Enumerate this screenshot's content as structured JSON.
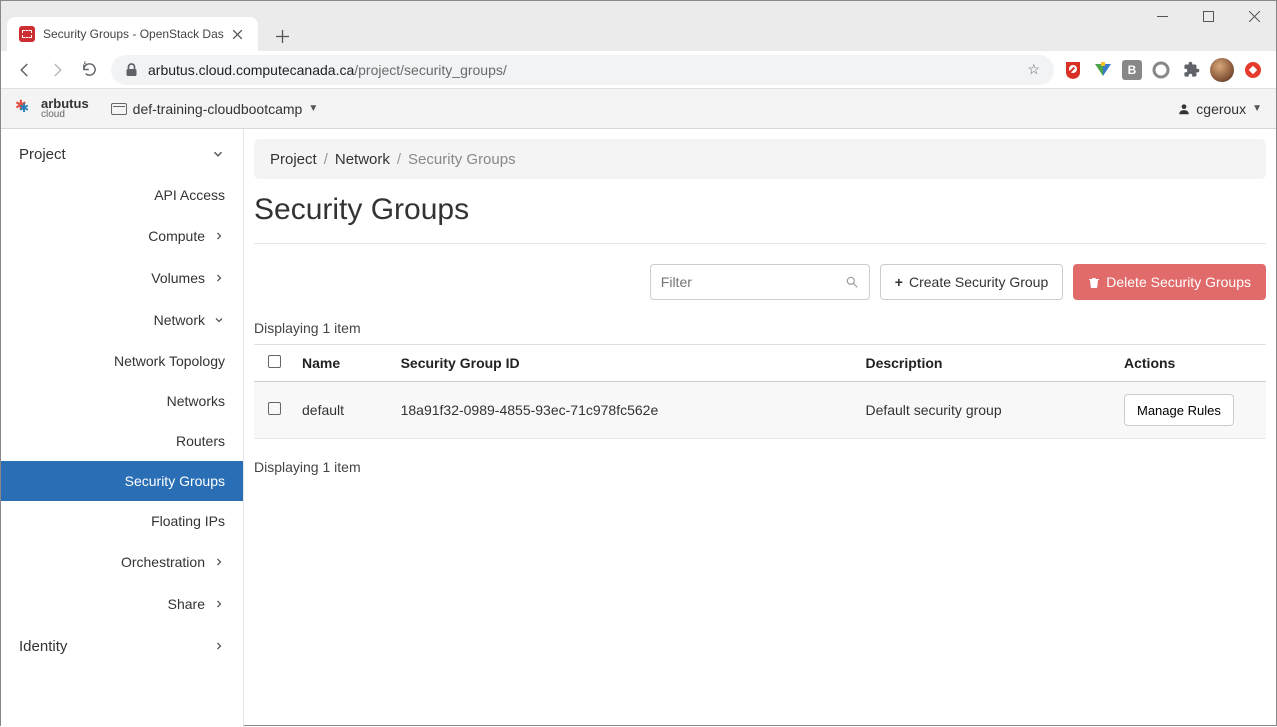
{
  "browser": {
    "tab_title": "Security Groups - OpenStack Das",
    "url_host": "arbutus.cloud.computecanada.ca",
    "url_path": "/project/security_groups/"
  },
  "app": {
    "brand_name": "arbutus",
    "brand_sub": "cloud",
    "project_name": "def-training-cloudbootcamp",
    "username": "cgeroux"
  },
  "sidebar": {
    "project": "Project",
    "api_access": "API Access",
    "compute": "Compute",
    "volumes": "Volumes",
    "network": "Network",
    "network_topology": "Network Topology",
    "networks": "Networks",
    "routers": "Routers",
    "security_groups": "Security Groups",
    "floating_ips": "Floating IPs",
    "orchestration": "Orchestration",
    "share": "Share",
    "identity": "Identity"
  },
  "breadcrumb": {
    "project": "Project",
    "network": "Network",
    "current": "Security Groups"
  },
  "page": {
    "title": "Security Groups",
    "filter_placeholder": "Filter",
    "create_btn": "Create Security Group",
    "delete_btn": "Delete Security Groups",
    "count_top": "Displaying 1 item",
    "count_bottom": "Displaying 1 item"
  },
  "table": {
    "headers": {
      "name": "Name",
      "sgid": "Security Group ID",
      "desc": "Description",
      "actions": "Actions"
    },
    "rows": [
      {
        "name": "default",
        "sgid": "18a91f32-0989-4855-93ec-71c978fc562e",
        "desc": "Default security group",
        "action": "Manage Rules"
      }
    ]
  }
}
